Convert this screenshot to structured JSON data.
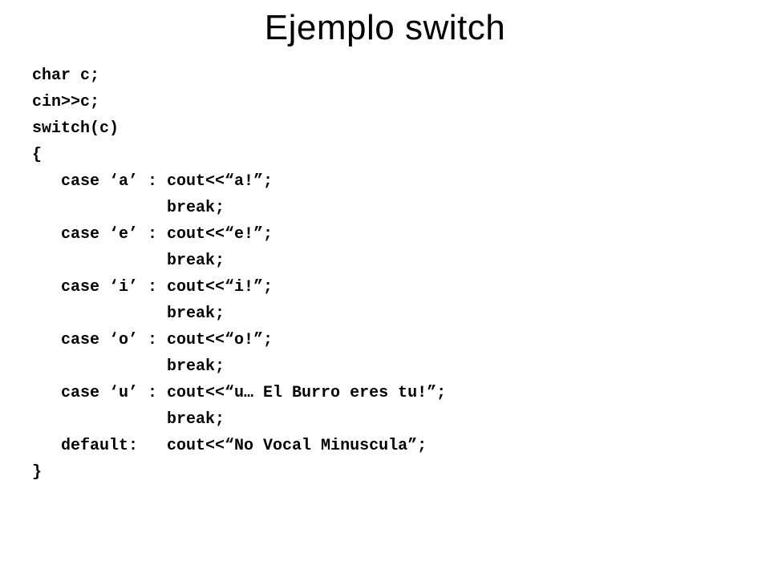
{
  "title": "Ejemplo switch",
  "code": {
    "line1": "char c;",
    "line2": "cin>>c;",
    "line3": "switch(c)",
    "line4": "{",
    "line5": "   case ‘a’ : cout<<“a!”;",
    "line6": "              break;",
    "line7": "   case ‘e’ : cout<<“e!”;",
    "line8": "              break;",
    "line9": "   case ‘i’ : cout<<“i!”;",
    "line10": "              break;",
    "line11": "   case ‘o’ : cout<<“o!”;",
    "line12": "              break;",
    "line13": "   case ‘u’ : cout<<“u… El Burro eres tu!”;",
    "line14": "              break;",
    "line15": "   default:   cout<<“No Vocal Minuscula”;",
    "line16": "}"
  }
}
